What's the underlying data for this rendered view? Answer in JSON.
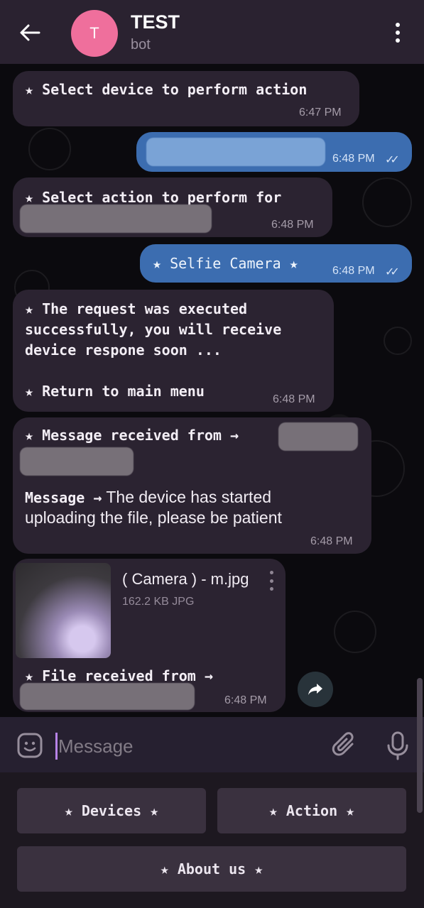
{
  "header": {
    "avatar_letter": "T",
    "title": "TEST",
    "subtitle": "bot",
    "back_icon": "arrow-left-icon",
    "menu_icon": "more-vertical-icon"
  },
  "messages": [
    {
      "type": "in",
      "text": "★ Select device to perform action",
      "time": "6:47 PM"
    },
    {
      "type": "out",
      "time": "6:48 PM"
    },
    {
      "type": "in",
      "text": "★ Select action to perform for",
      "time": "6:48 PM"
    },
    {
      "type": "out",
      "text": "★ Selfie Camera ★",
      "time": "6:48 PM"
    },
    {
      "type": "in",
      "lines": [
        "★ The request was executed",
        "successfully, you will receive",
        "device respone soon ...",
        "",
        "★ Return to main menu"
      ],
      "time": "6:48 PM"
    },
    {
      "type": "in",
      "head": "★ Message received from →",
      "label": "Message →",
      "body_line1": " The device has started",
      "body_line2": "uploading the file, please be patient",
      "time": "6:48 PM"
    },
    {
      "type": "in",
      "file_name": "( Camera ) - m.jpg",
      "file_meta": "162.2 KB JPG",
      "text": "★ File received from →",
      "time": "6:48 PM"
    }
  ],
  "composer": {
    "placeholder": "Message",
    "sticker_icon": "sticker-icon",
    "attach_icon": "paperclip-icon",
    "mic_icon": "microphone-icon"
  },
  "keyboard": {
    "devices": "★ Devices ★",
    "action": "★ Action ★",
    "about": "★ About us ★"
  },
  "colors": {
    "header_bg": "#2a2230",
    "incoming_bubble": "#2b2331",
    "outgoing_bubble": "#3c6db0",
    "avatar": "#ef6f9c",
    "cursor": "#b783e8"
  }
}
